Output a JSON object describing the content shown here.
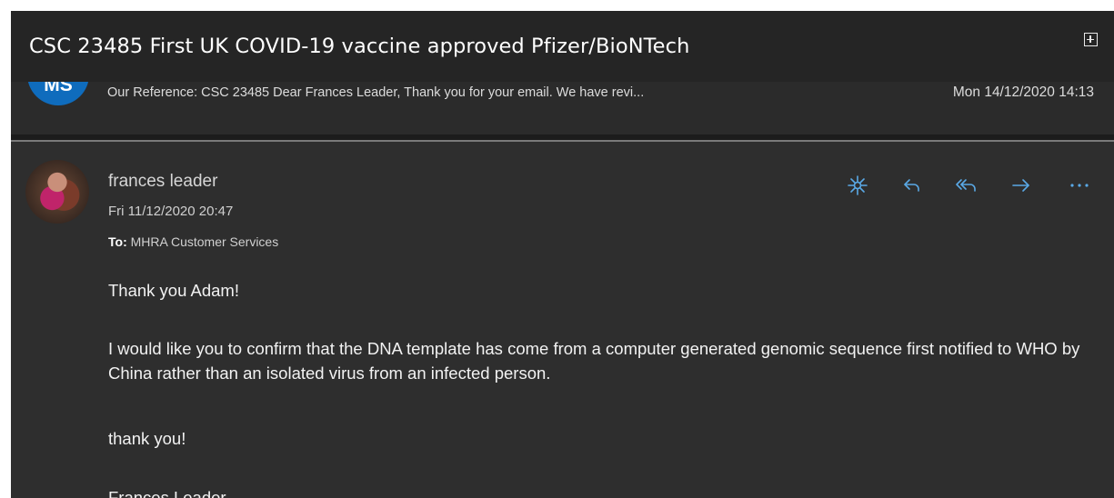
{
  "email": {
    "subject": "CSC 23485 First UK COVID-19 vaccine approved Pfizer/BioNTech",
    "thread": {
      "avatar_initials": "MS",
      "preview": "Our Reference: CSC 23485 Dear Frances Leader, Thank you for your email. We have revi...",
      "date": "Mon 14/12/2020 14:13"
    },
    "message": {
      "sender": "frances leader",
      "date": "Fri 11/12/2020 20:47",
      "to_label": "To:",
      "to_value": "MHRA Customer Services",
      "body": {
        "line1": "Thank you Adam!",
        "line2": "I would like you to confirm that the DNA template has come from a computer generated genomic sequence first notified to WHO by China rather than an isolated virus from an infected person.",
        "line3": "thank you!",
        "line4": "Frances Leader"
      }
    },
    "actions": [
      "sparkle-icon",
      "reply-icon",
      "reply-all-icon",
      "forward-icon",
      "more-icon"
    ]
  },
  "colors": {
    "accent": "#5aa9e6",
    "background": "#2e2e2e",
    "title_bar": "#252525",
    "avatar_blue": "#0f6cbd"
  }
}
